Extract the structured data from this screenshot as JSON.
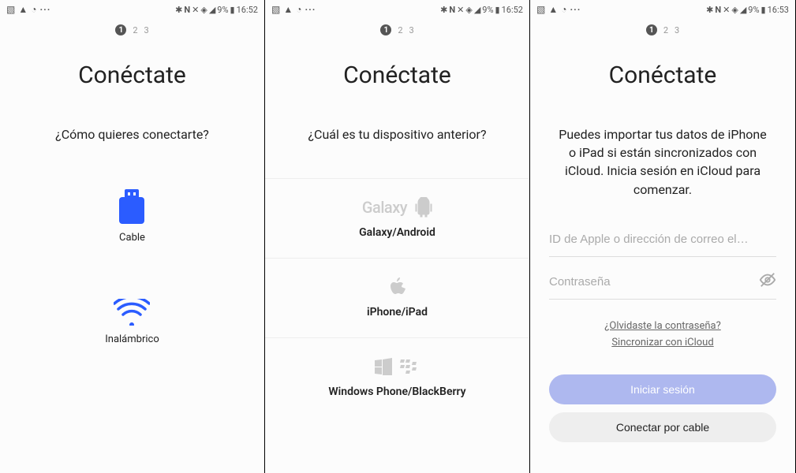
{
  "status": {
    "battery": "9%",
    "time_a": "16:52",
    "time_b": "16:53"
  },
  "stepper": {
    "current": "1",
    "rest": [
      "2",
      "3"
    ]
  },
  "title": "Conéctate",
  "screen1": {
    "subtitle": "¿Cómo quieres conectarte?",
    "cable": "Cable",
    "wireless": "Inalámbrico"
  },
  "screen2": {
    "subtitle": "¿Cuál es tu dispositivo anterior?",
    "galaxy_logo": "Galaxy",
    "galaxy": "Galaxy/Android",
    "iphone": "iPhone/iPad",
    "winbb": "Windows Phone/BlackBerry"
  },
  "screen3": {
    "desc": "Puedes importar tus datos de iPhone o iPad si están sincronizados con iCloud. Inicia sesión en iCloud para comenzar.",
    "apple_id_placeholder": "ID de Apple o dirección de correo el…",
    "password_placeholder": "Contraseña",
    "forgot": "¿Olvidaste la contraseña?",
    "sync": "Sincronizar con iCloud",
    "login": "Iniciar sesión",
    "cable_connect": "Conectar por cable"
  }
}
